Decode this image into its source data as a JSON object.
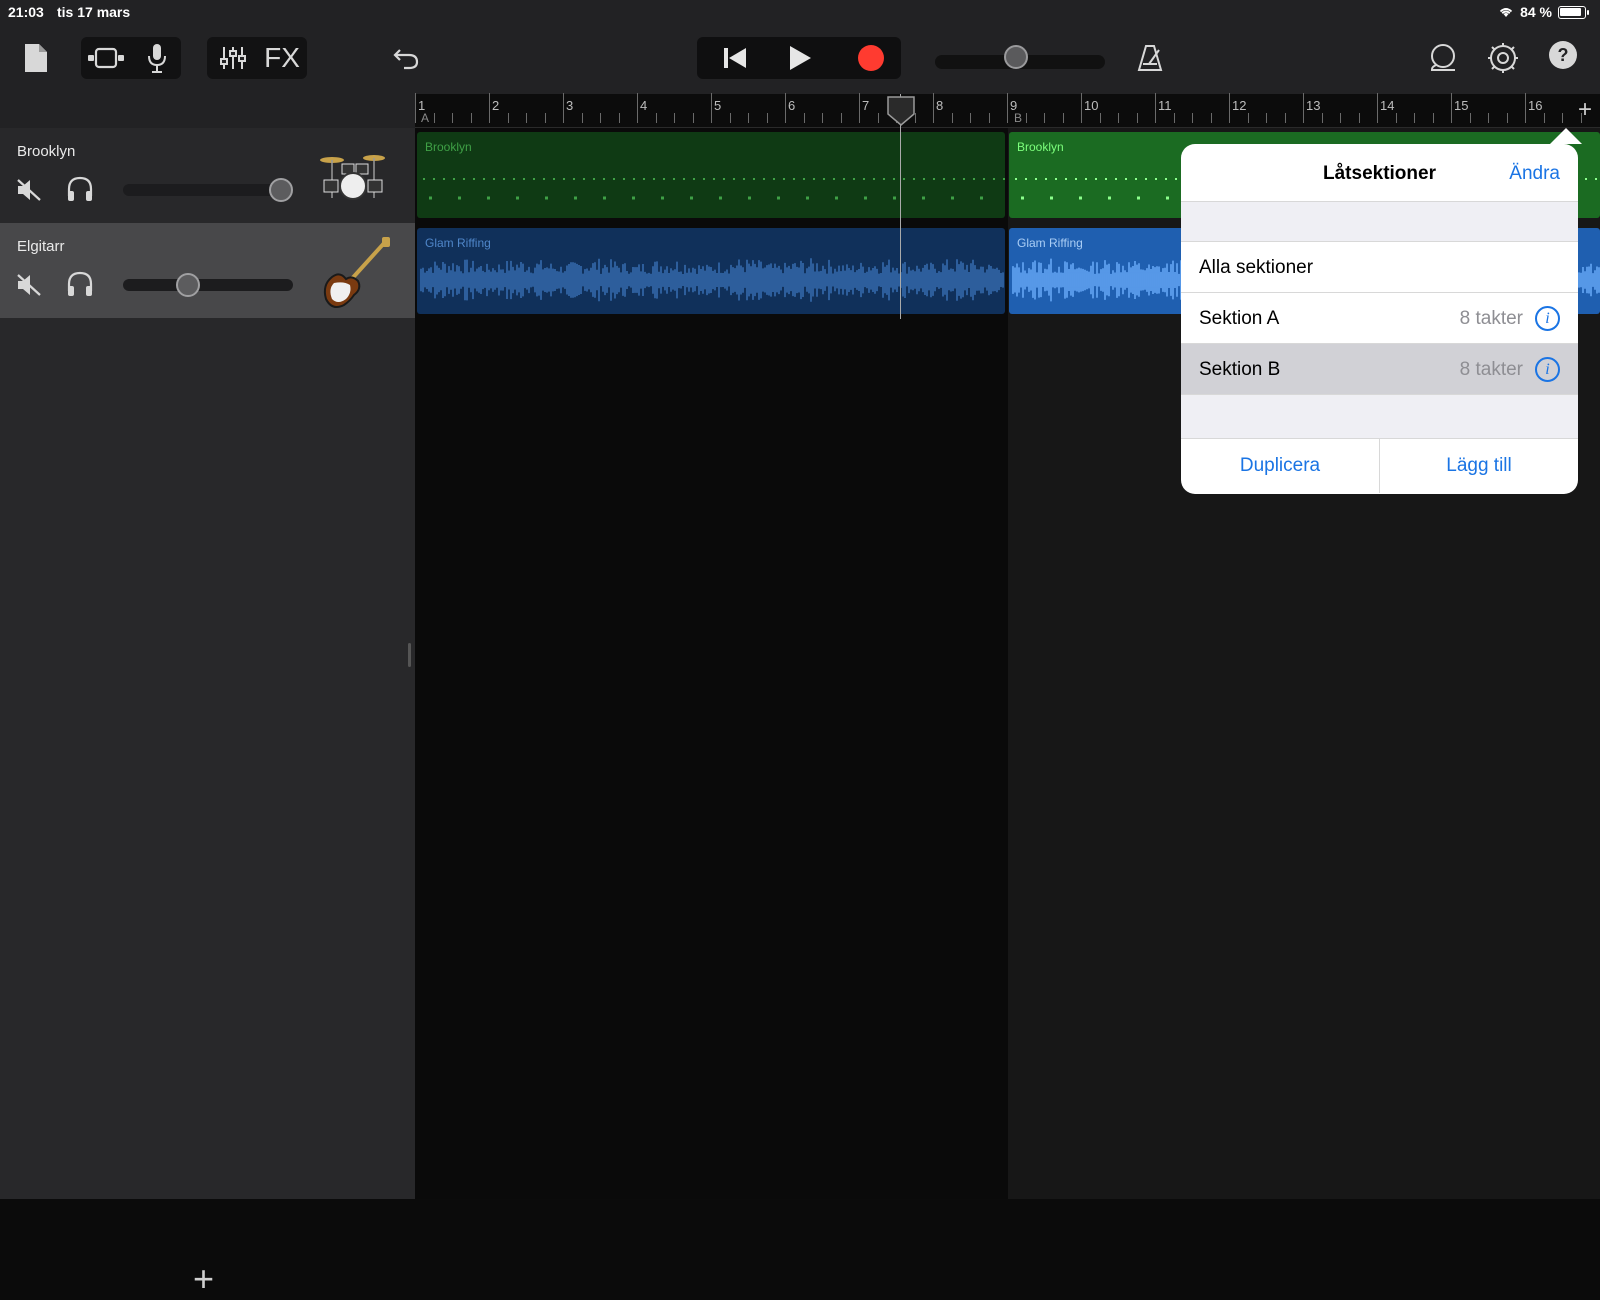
{
  "status": {
    "time": "21:03",
    "date": "tis 17 mars",
    "battery": "84 %"
  },
  "toolbar": {
    "icons": [
      "document-icon",
      "track-view-icon",
      "microphone-icon",
      "mixer-icon",
      "undo-icon",
      "rewind-icon",
      "play-icon",
      "record-icon",
      "metronome-icon",
      "loop-icon",
      "settings-icon",
      "help-icon"
    ],
    "fx_label": "FX",
    "help_label": "?"
  },
  "ruler": {
    "bars": [
      "1",
      "2",
      "3",
      "4",
      "5",
      "6",
      "7",
      "8",
      "9",
      "10",
      "11",
      "12",
      "13",
      "14",
      "15",
      "16"
    ],
    "section_a": "A",
    "section_b": "B",
    "add_label": "+"
  },
  "tracks": [
    {
      "name": "Brooklyn",
      "volume": 0.9,
      "instrument_icon": "drum-kit-icon"
    },
    {
      "name": "Elgitarr",
      "volume": 0.4,
      "instrument_icon": "electric-guitar-icon"
    }
  ],
  "regions": {
    "brooklyn_a": "Brooklyn",
    "brooklyn_b": "Brooklyn",
    "guitar_a": "Glam Riffing",
    "guitar_b": "Glam Riffing"
  },
  "add_track_label": "+",
  "popover": {
    "title": "Låtsektioner",
    "edit": "Ändra",
    "all_sections": "Alla sektioner",
    "sections": [
      {
        "name": "Sektion A",
        "length": "8 takter",
        "selected": false
      },
      {
        "name": "Sektion B",
        "length": "8 takter",
        "selected": true
      }
    ],
    "info_glyph": "i",
    "duplicate": "Duplicera",
    "add": "Lägg till"
  },
  "colors": {
    "accent": "#1a74e4",
    "record": "#ff3b30",
    "drums_region": "#1b6b22",
    "guitar_region": "#1f5fb0"
  }
}
